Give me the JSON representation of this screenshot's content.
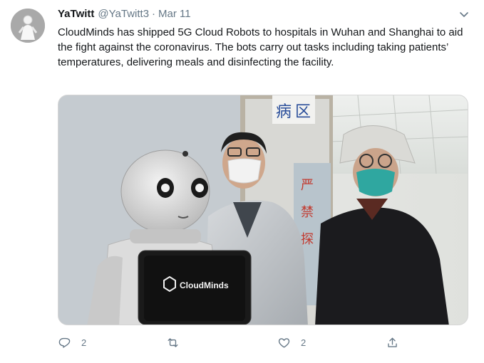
{
  "tweet": {
    "display_name": "YaTwitt",
    "handle": "@YaTwitt3",
    "separator": "·",
    "date": "Mar 11",
    "text": "CloudMinds has shipped 5G Cloud Robots to hospitals in Wuhan and Shanghai to aid the fight against the coronavirus. The bots carry out tasks including taking patients’ temperatures, delivering meals and disinfecting the facility."
  },
  "media": {
    "robot_screen_logo": "CloudMinds",
    "ward_sign_chars": [
      "病",
      "区"
    ],
    "door_sign_chars": [
      "严",
      "禁",
      "探"
    ]
  },
  "actions": {
    "reply": {
      "icon": "reply-icon",
      "count": "2"
    },
    "retweet": {
      "icon": "retweet-icon",
      "count": ""
    },
    "like": {
      "icon": "heart-icon",
      "count": "2"
    },
    "share": {
      "icon": "share-icon",
      "count": ""
    }
  },
  "colors": {
    "text": "#14171a",
    "secondary": "#657786",
    "border": "#e6ecf0"
  }
}
